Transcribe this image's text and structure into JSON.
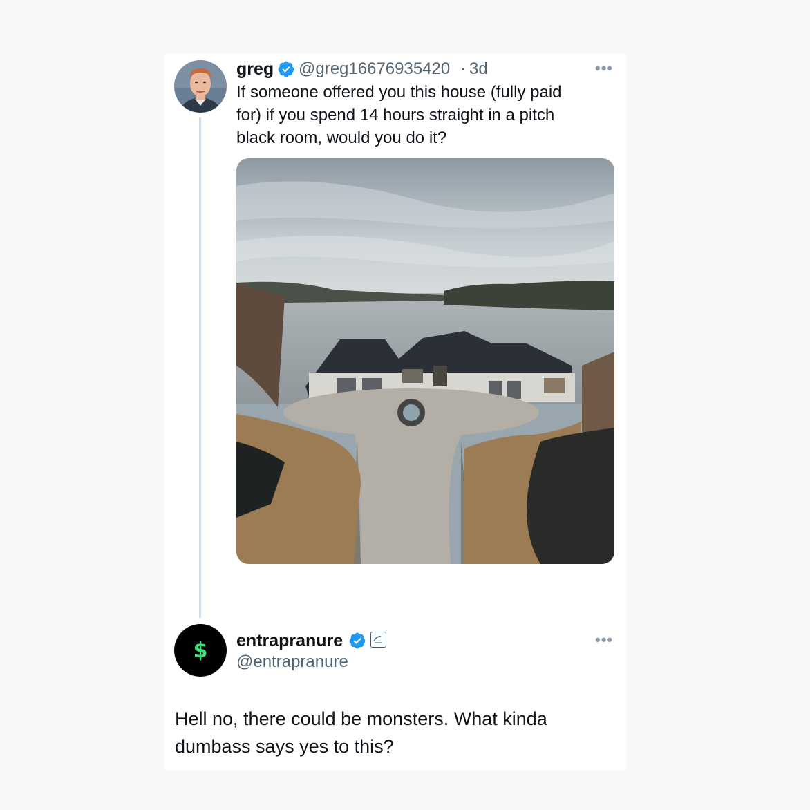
{
  "original_tweet": {
    "author_name": "greg",
    "author_handle": "@greg16676935420",
    "separator": "·",
    "timestamp": "3d",
    "text_lines": [
      "If someone offered you this house (fully paid",
      "for) if you spend 14 hours straight in a pitch",
      "black room, would you do it?"
    ],
    "avatar_icon": "profile-photo",
    "more_icon": "ellipsis-icon",
    "verified": true
  },
  "reply_tweet": {
    "author_name": "entrapranure",
    "author_handle": "@entrapranure",
    "avatar_symbol": "$",
    "text_lines": [
      "Hell no, there could be monsters. What kinda",
      "dumbass says yes to this?"
    ],
    "more_icon": "ellipsis-icon",
    "verified": true,
    "affiliate_badge_icon": "affiliate-badge-icon"
  },
  "colors": {
    "verified_blue": "#1d9bf0",
    "dollar_green": "#3ee07a",
    "text_primary": "#0f1419",
    "text_secondary": "#536471"
  }
}
